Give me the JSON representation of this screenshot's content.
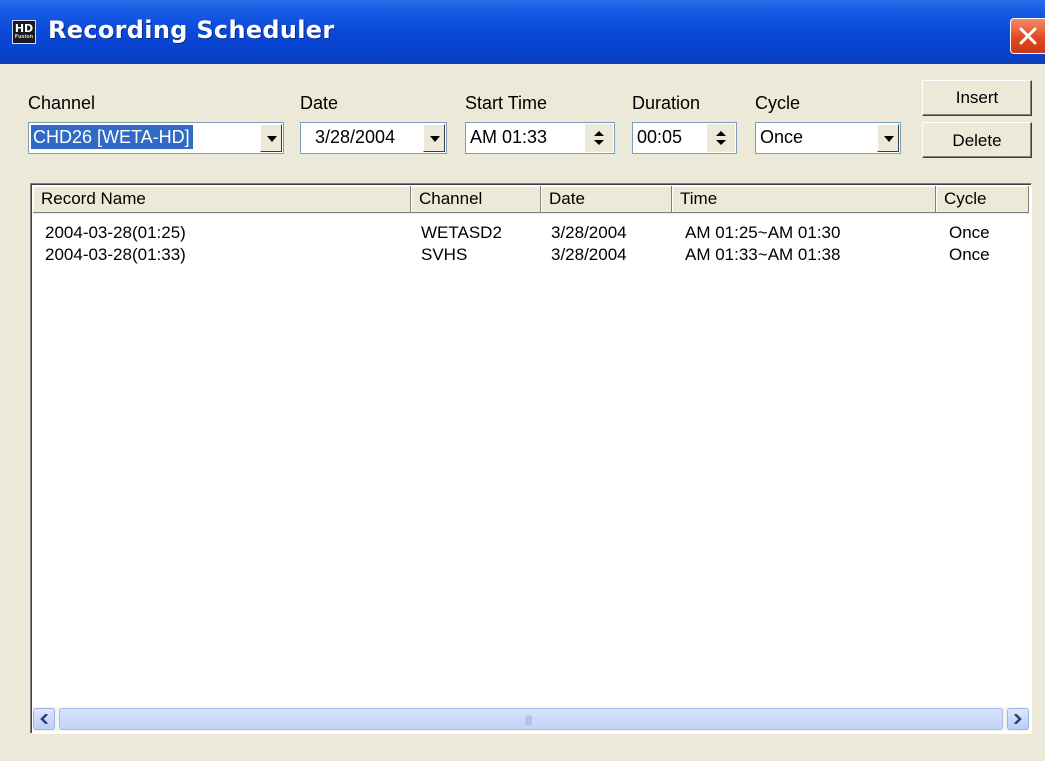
{
  "window": {
    "title": "Recording Scheduler",
    "icon_text": "HD",
    "icon_subtext": "Fusion"
  },
  "form": {
    "channel_label": "Channel",
    "channel_value": "CHD26 [WETA-HD]",
    "date_label": "Date",
    "date_value": "3/28/2004",
    "start_time_label": "Start Time",
    "start_time_value": "AM 01:33",
    "duration_label": "Duration",
    "duration_value": "00:05",
    "cycle_label": "Cycle",
    "cycle_value": "Once"
  },
  "buttons": {
    "insert": "Insert",
    "delete": "Delete"
  },
  "list": {
    "columns": [
      "Record Name",
      "Channel",
      "Date",
      "Time",
      "Cycle"
    ],
    "rows": [
      [
        "2004-03-28(01:25)",
        "WETASD2",
        "3/28/2004",
        "AM 01:25~AM 01:30",
        "Once"
      ],
      [
        "2004-03-28(01:33)",
        "SVHS",
        "3/28/2004",
        "AM 01:33~AM 01:38",
        "Once"
      ]
    ]
  },
  "colors": {
    "titlebar": "#0b49d8",
    "close": "#e0451f",
    "selection": "#316ac5",
    "face": "#ece9d8"
  },
  "icons": [
    "hd-fusion-app-icon",
    "close-icon",
    "dropdown-arrow-icon",
    "spin-up-icon",
    "spin-down-icon",
    "scroll-left-icon",
    "scroll-right-icon"
  ]
}
